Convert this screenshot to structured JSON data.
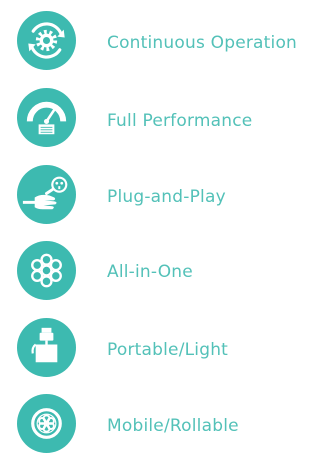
{
  "colors": {
    "accent": "#3dbab0",
    "label": "#53c1b8",
    "icon_fg": "#ffffff"
  },
  "features": [
    {
      "icon": "gear-cycle-icon",
      "label": "Continuous Operation"
    },
    {
      "icon": "speedometer-icon",
      "label": "Full Performance"
    },
    {
      "icon": "hand-plug-icon",
      "label": "Plug-and-Play"
    },
    {
      "icon": "circle-cluster-icon",
      "label": "All-in-One"
    },
    {
      "icon": "battery-pack-icon",
      "label": "Portable/Light"
    },
    {
      "icon": "wheel-icon",
      "label": "Mobile/Rollable"
    }
  ]
}
